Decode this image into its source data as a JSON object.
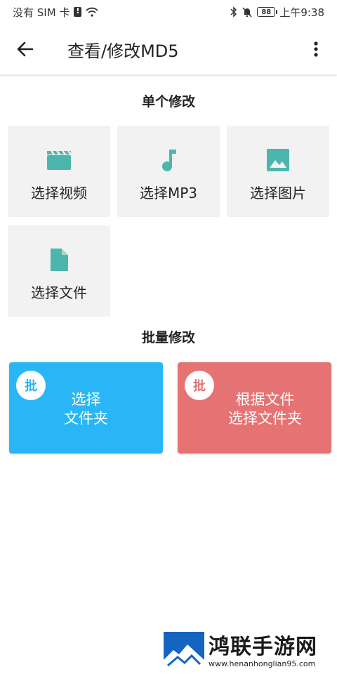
{
  "status_bar": {
    "carrier": "没有 SIM 卡",
    "battery": "88",
    "time": "上午9:38"
  },
  "app_bar": {
    "title": "查看/修改MD5"
  },
  "single": {
    "heading": "单个修改",
    "tiles": [
      {
        "label": "选择视频",
        "icon": "clapperboard-icon"
      },
      {
        "label": "选择MP3",
        "icon": "music-note-icon"
      },
      {
        "label": "选择图片",
        "icon": "image-icon"
      },
      {
        "label": "选择文件",
        "icon": "file-icon"
      }
    ],
    "icon_color": "#4db6ac",
    "tile_bg": "#f2f2f2"
  },
  "batch": {
    "heading": "批量修改",
    "cards": [
      {
        "badge": "批",
        "line1": "选择",
        "line2": "文件夹",
        "color": "#29b6f6"
      },
      {
        "badge": "批",
        "line1": "根据文件",
        "line2": "选择文件夹",
        "color": "#e57373"
      }
    ]
  },
  "watermark": {
    "title": "鸿联手游网",
    "url": "www.henanhonglian95.com"
  }
}
